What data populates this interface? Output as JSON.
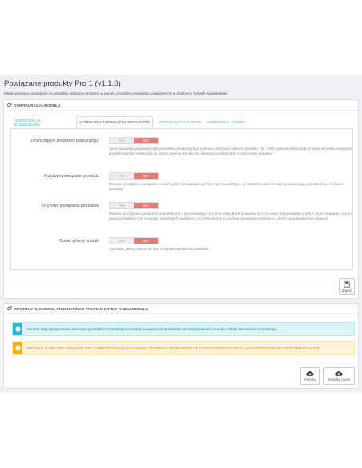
{
  "page": {
    "title": "Powiązane produkty Pro 1 (v1.1.0)",
    "subtitle": "Moduł pozwala na dodanie do produktu na karcie produktu w panelu przednim produktów powiązanych w 4 różnych trybach wyświetlania"
  },
  "config_panel": {
    "heading": "KONFIGURACJA MODUŁU",
    "tabs": [
      {
        "label": "KONFIGURACJA WYŚWIETLANIA",
        "active": false
      },
      {
        "label": "KONFIGURACJA POWIĄZAŃ PRODUKTÓW",
        "active": true
      },
      {
        "label": "KONFIGURACJA SLIDERA",
        "active": false
      },
      {
        "label": "KONFIGURACJA TABELI",
        "active": false
      }
    ],
    "fields": [
      {
        "label": "Zmień zdjęcie produktów powiązanych",
        "yes": "TAK",
        "no": "NIE",
        "value": "NIE",
        "help": "Opcja pozwala na podmianę zdjęć produktów powiązanych po wybraniu kombinacji na karcie produktu - np.: \"Jeśli wybieramy kolor biały to wtedy wszystkie powiązane produkty zostaną przełaczone na zdjęcia z wersją gdy jest ona dostępna w kolorze biały w tym samym wariancie\""
      },
      {
        "label": "Krzyżowe powiązanie produktu",
        "yes": "TAK",
        "no": "NIE",
        "value": "NIE",
        "help": "Pozwala na krzyżowe powiązanie produktu jeśli A jest powiązany z B to B jest powiązany z A (niezależnie czy to w karcie powiązanego produktu B do A na karcie produktu)"
      },
      {
        "label": "Krzyżowe powiązania produktów",
        "yes": "TAK",
        "no": "NIE",
        "value": "NIE",
        "help": "Pozwala na krzyżowe powiązanie produktów jeśli A jest powiązany z B,C,D to wtedy B jest powiązany z A,C,D oraz C jest powiązany z A,B,D i D jest powiązany z A,B,C (opcja szczególnie czas na etapie powiązanych produktów A,B,C,D wystarczy to krzyżowe powiązanie produktu A a reszta się automatycznie powiąże)"
      },
      {
        "label": "Dodać główny produkt",
        "yes": "TAK",
        "no": "NIE",
        "value": "NIE",
        "help": "Czy dodać główny produkt do listy \"Krzyżowe powiązania produktów\""
      }
    ],
    "save_label": "Zapisz"
  },
  "import_panel": {
    "heading": "IMPORTUJ AKCESORIA PRODUKTÓW Z PRESTASHOP DO TABELI MODUŁU",
    "info_alert": "Możesz tutaj zaimportować akcesoria produktów Prestashop do modułu powiązanych produktów lub zaimportować i usunąć z tabeli akcesoriów Prestashop.",
    "warning_alert": "PROSIMY O UWAŻNE UŻYWANIE OPCJI IMPORTOWANIA I USUWANIA, PONIEWAŻ TO SPOWODUJE USUNIĘCIE WSZYSTKICH AKCESORIÓW PRODUKTÓW PRESTASHOP.",
    "import_button": "Importuj",
    "import_delete_button": "Importuj i usuń"
  },
  "colors": {
    "accent": "#25b9d7",
    "switch_no": "#e27c79",
    "warning": "#fab000"
  }
}
